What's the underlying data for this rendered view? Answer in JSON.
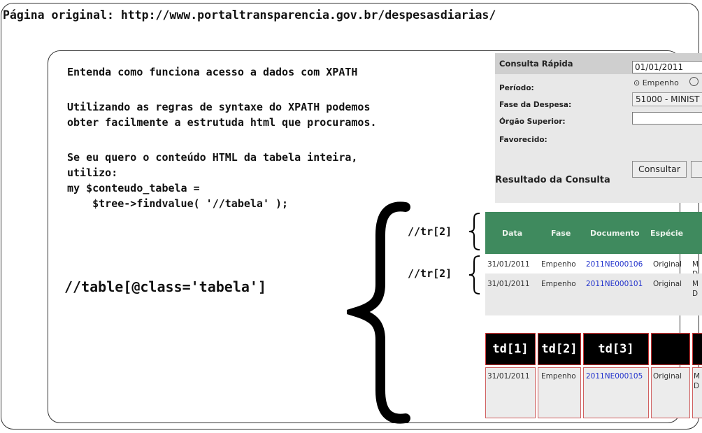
{
  "slide": {
    "page_url": "Página original: http://www.portaltransparencia.gov.br/despesasdiarias/",
    "code_lines": [
      "Entenda como funciona acesso a dados com XPATH",
      "",
      "Utilizando as regras de syntaxe do XPATH podemos",
      "obter facilmente a estrutuda html que procuramos.",
      "",
      "Se eu quero o conteúdo HTML da tabela inteira,",
      "utilizo:",
      "my $conteudo_tabela =",
      "    $tree->findvalue( '//tabela' );"
    ],
    "xpath_table": "//table[@class='tabela']",
    "xpath_tr_header": "//tr[2]",
    "xpath_tr_row": "//tr[2]"
  },
  "form": {
    "title": "Consulta Rápida",
    "periodo_label": "Período:",
    "periodo_value": "01/01/2011",
    "fase_label": "Fase da Despesa:",
    "fase_option": "Empenho",
    "orgao_label": "Órgão Superior:",
    "orgao_value": "51000 - MINIST",
    "favorecido_label": "Favorecido:",
    "favorecido_value": "",
    "consultar_button": "Consultar"
  },
  "results": {
    "title": "Resultado da Consulta",
    "columns": [
      "Data",
      "Fase",
      "Documento",
      "Espécie"
    ],
    "rows": [
      {
        "data": "31/01/2011",
        "fase": "Empenho",
        "documento": "2011NE000106",
        "especie": "Original",
        "extra1": "M",
        "extra2": "D"
      },
      {
        "data": "31/01/2011",
        "fase": "Empenho",
        "documento": "2011NE000101",
        "especie": "Original",
        "extra1": "M",
        "extra2": "D"
      },
      {
        "data": "31/01/2011",
        "fase": "Empenho",
        "documento": "2011NE000105",
        "especie": "Original",
        "extra1": "M",
        "extra2": "D"
      }
    ],
    "td_labels": [
      "td[1]",
      "td[2]",
      "td[3]"
    ]
  },
  "colors": {
    "table_header_green": "#3f8a5e",
    "link_blue": "#2233cc",
    "highlight_red": "#cc3333"
  }
}
